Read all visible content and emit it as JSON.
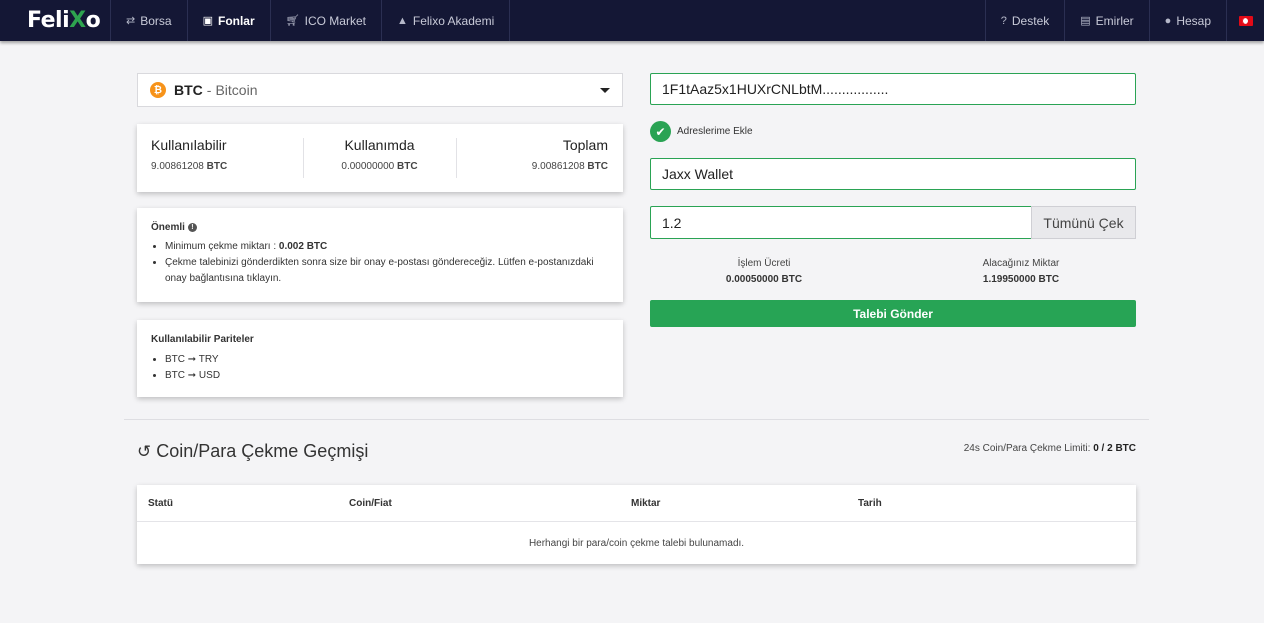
{
  "nav": {
    "logo": {
      "left": "Feli",
      "x": "X",
      "right": "o"
    },
    "items": [
      {
        "label": "Borsa",
        "icon": "exchange-icon"
      },
      {
        "label": "Fonlar",
        "icon": "money-icon",
        "active": true
      },
      {
        "label": "ICO Market",
        "icon": "cart-icon"
      },
      {
        "label": "Felixo Akademi",
        "icon": "graduation-cap-icon"
      }
    ],
    "right_items": [
      {
        "label": "Destek",
        "icon": "question-icon"
      },
      {
        "label": "Emirler",
        "icon": "document-icon"
      },
      {
        "label": "Hesap",
        "icon": "user-icon"
      }
    ],
    "flag": "turkey-flag-icon"
  },
  "currency": {
    "code": "BTC",
    "separator": "-",
    "name": "Bitcoin",
    "coin_symbol": "₿"
  },
  "balances": [
    {
      "title": "Kullanılabilir",
      "amount": "9.00861208",
      "unit": "BTC"
    },
    {
      "title": "Kullanımda",
      "amount": "0.00000000",
      "unit": "BTC"
    },
    {
      "title": "Toplam",
      "amount": "9.00861208",
      "unit": "BTC"
    }
  ],
  "important": {
    "title": "Önemli",
    "min_prefix": "Minimum çekme miktarı : ",
    "min_value": "0.002 BTC",
    "note": "Çekme talebinizi gönderdikten sonra size bir onay e-postası göndereceğiz. Lütfen e-postanızdaki onay bağlantısına tıklayın."
  },
  "pairs": {
    "title": "Kullanılabilir Pariteler",
    "items": [
      "BTC ➞ TRY",
      "BTC ➞ USD"
    ]
  },
  "form": {
    "address": "1F1tAaz5x1HUXrCNLbtM.................",
    "add_to_addresses": "Adreslerime Ekle",
    "wallet": "Jaxx Wallet",
    "amount": "1.2",
    "withdraw_all": "Tümünü Çek",
    "fee_label": "İşlem Ücreti",
    "fee_value": "0.00050000 BTC",
    "receive_label": "Alacağınız Miktar",
    "receive_value": "1.19950000 BTC",
    "submit": "Talebi Gönder"
  },
  "history": {
    "title": "Coin/Para Çekme Geçmişi",
    "limit_label": "24s Coin/Para Çekme Limiti:",
    "limit_value": "0 / 2 BTC",
    "columns": [
      "Statü",
      "Coin/Fiat",
      "Miktar",
      "Tarih"
    ],
    "empty": "Herhangi bir para/coin çekme talebi bulunamadı."
  },
  "colors": {
    "nav_bg": "#141735",
    "accent_green": "#27a455",
    "btc_orange": "#f7931a"
  }
}
